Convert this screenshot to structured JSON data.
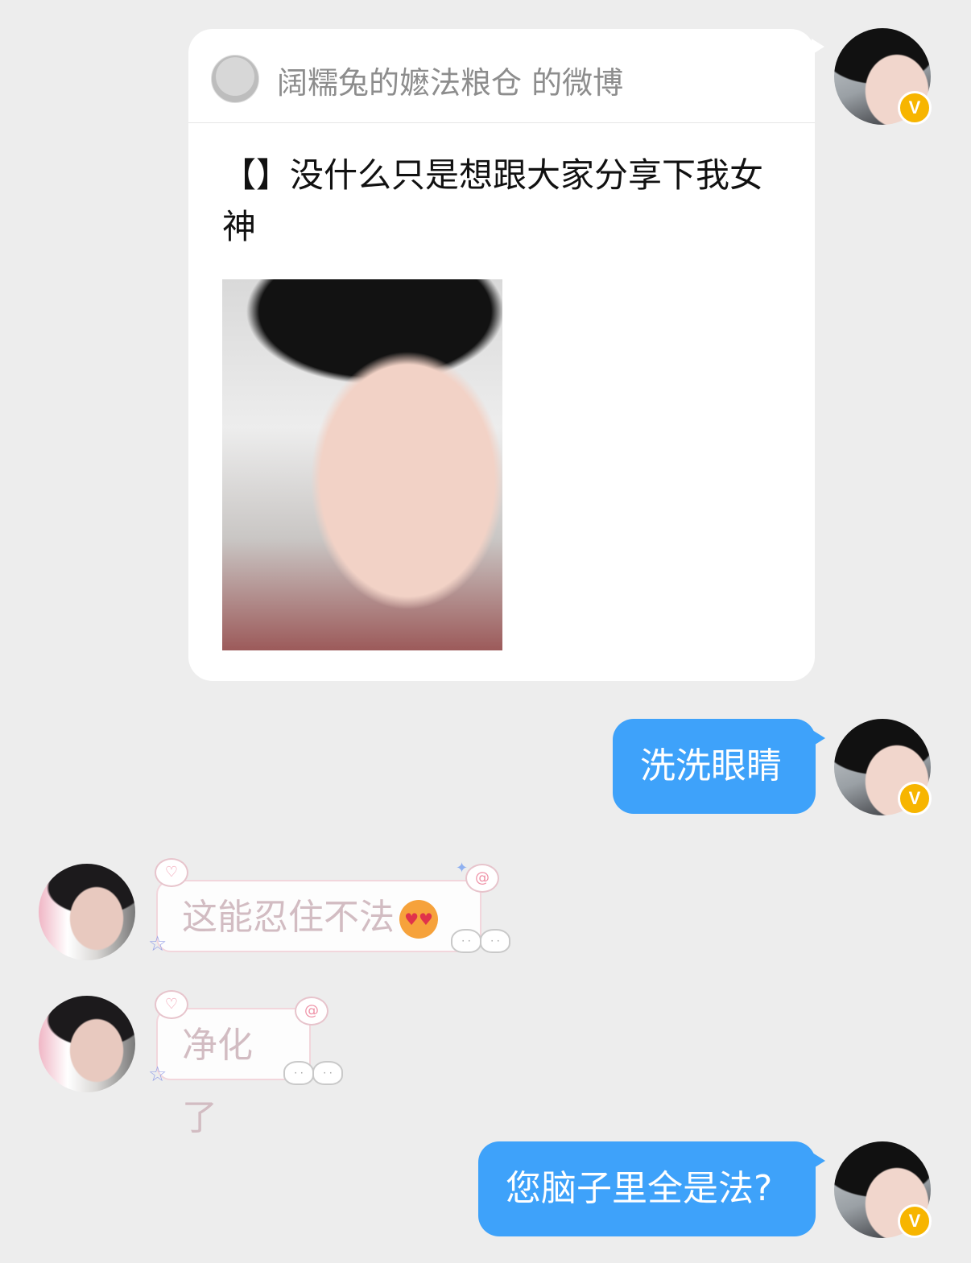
{
  "shared_card": {
    "source_name": "阔糯兔的嬷法粮仓 的微博",
    "text": "【】没什么只是想跟大家分享下我女神"
  },
  "messages": [
    {
      "side": "right",
      "text": "洗洗眼睛"
    },
    {
      "side": "left",
      "text": "这能忍住不法"
    },
    {
      "side": "left",
      "text": "净化了"
    },
    {
      "side": "right",
      "text": "您脑子里全是法?"
    }
  ],
  "badges": {
    "verified": "V"
  },
  "colors": {
    "background": "#ededed",
    "bubble_blue": "#3ea2fa",
    "verified_badge": "#f7b500"
  },
  "icons": {
    "shared_card_photo": "profile-photo",
    "deco": [
      "heart-cloud-icon",
      "swirl-cloud-icon",
      "bunny-icon",
      "star-icon",
      "sparkle-icon"
    ],
    "emoji": "heart-eyes-emoji-icon"
  }
}
